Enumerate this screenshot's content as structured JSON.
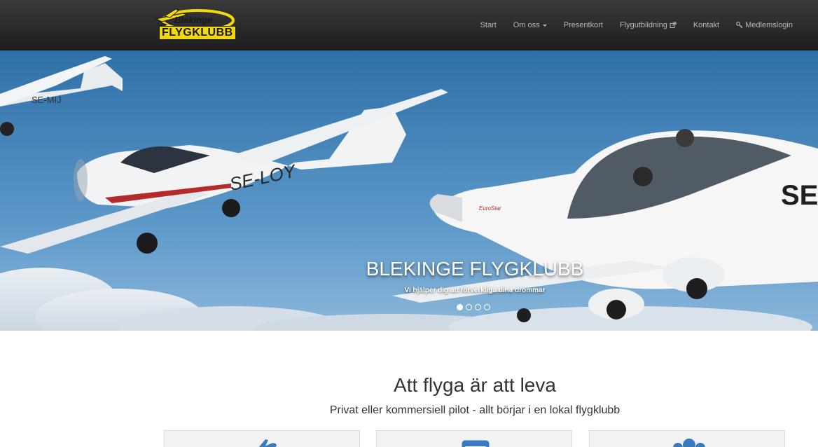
{
  "brand": {
    "logo_line1": "Blekinge",
    "logo_line2": "FLYGKLUBB",
    "logo_color": "#f4d80e"
  },
  "nav": {
    "start": "Start",
    "om_oss": "Om oss",
    "presentkort": "Presentkort",
    "flygutbildning": "Flygutbildning",
    "kontakt": "Kontakt",
    "medlemslogin": "Medlemslogin"
  },
  "hero": {
    "title": "BLEKINGE FLYGKLUBB",
    "subtitle": "Vi hjälper dig att förverkliga dina drömmar",
    "registration_left": "SE-MIJ",
    "registration_mid": "SE-LOY",
    "registration_right": "SE",
    "brand_text": "EuroStar",
    "slide_count": 4,
    "active_slide": 1
  },
  "intro": {
    "headline": "Att flyga är att leva",
    "subline": "Privat eller kommersiell pilot - allt börjar i en lokal flygklubb"
  },
  "cards": {
    "icons": [
      "plane-icon",
      "card-icon",
      "group-icon"
    ],
    "icon_color": "#3a7ac0"
  }
}
